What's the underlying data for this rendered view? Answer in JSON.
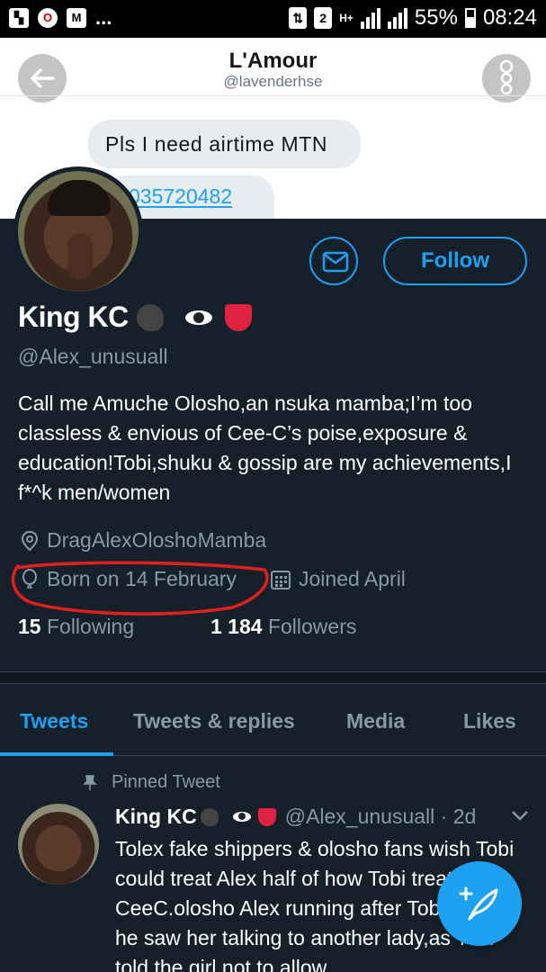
{
  "statusbar": {
    "left_icons": [
      "bbm-icon",
      "opera-icon",
      "gmail-icon"
    ],
    "more": "...",
    "notif_count": "2",
    "network": "H+",
    "battery": "55%",
    "time": "08:24"
  },
  "dm": {
    "title": "L'Amour",
    "handle": "@lavenderhse",
    "messages": [
      "Pls I need airtime MTN",
      "035720482"
    ]
  },
  "profile": {
    "name": "King KC",
    "handle": "@Alex_unusuall",
    "bio": "Call me Amuche Olosho,an nsuka mamba;I’m too classless & envious of Cee-C’s poise,exposure & education!Tobi,shuku & gossip are my achievements,I f*^k men/women",
    "location": "DragAlexOloshoMamba",
    "born": "Born on 14 February",
    "joined": "Joined April",
    "following_count": "15",
    "following_label": "Following",
    "followers_count": "1 184",
    "followers_label": "Followers",
    "follow_label": "Follow"
  },
  "tabs": [
    "Tweets",
    "Tweets & replies",
    "Media",
    "Likes"
  ],
  "active_tab": "Tweets",
  "tweet": {
    "pinned_label": "Pinned Tweet",
    "name": "King KC",
    "handle_time": "@Alex_unusuall · 2d",
    "text": "Tolex fake shippers & olosho fans wish Tobi could treat Alex half of how Tobi treats CeeC.olosho Alex running after Tobi when he saw her talking to another lady,as Tobi told the girl not to allow"
  },
  "colors": {
    "background": "#15202b",
    "accent": "#1da1f2",
    "secondary_text": "#8899a6",
    "annotation": "#e0201b"
  }
}
